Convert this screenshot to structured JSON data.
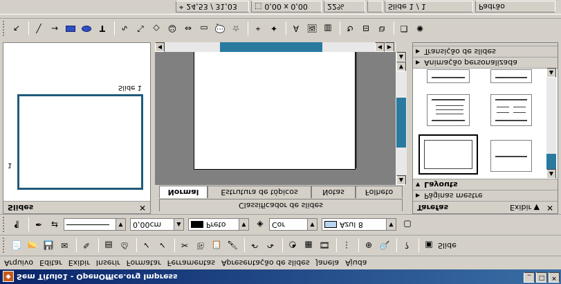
{
  "window": {
    "title": "Sem Título1 - OpenOffice.org Impress",
    "app_icon": "impress-app-icon",
    "controls": [
      "minimize",
      "maximize",
      "close"
    ]
  },
  "menu": [
    "Arquivo",
    "Editar",
    "Exibir",
    "Inserir",
    "Formatar",
    "Ferramentas",
    "Apresentação de slides",
    "Janela",
    "Ajuda"
  ],
  "standard_toolbar": {
    "slide_button_label": "Slide"
  },
  "line_fill_toolbar": {
    "line_width": "0,00cm",
    "line_color": "Preto",
    "line_color_hex": "#000000",
    "area_style": "Cor",
    "area_color": "Azul 8",
    "area_color_hex": "#b8d4f0"
  },
  "slides_pane": {
    "title": "Slides",
    "slide_label": "Slide 1",
    "slide_number": "1"
  },
  "view_tabs": [
    "Normal",
    "Estrutura de tópicos",
    "Notas",
    "Folheto"
  ],
  "view_tab_sorter": "Classificador de slides",
  "task_pane": {
    "title": "Tarefas",
    "view_menu": "Exibir",
    "sections": [
      "Páginas mestre",
      "Layouts",
      "Animação personalizada",
      "Transição de slides"
    ]
  },
  "status_bar": {
    "position": "24,53 / 31,03",
    "size": "0,00 x 0,00",
    "zoom": "22%",
    "slide": "Slide 1 / 1",
    "master": "Padrão"
  },
  "colors": {
    "title_bar": "#0a246a",
    "slide_border": "#1f5a7a",
    "scroll_accent": "#2a7aa0"
  }
}
